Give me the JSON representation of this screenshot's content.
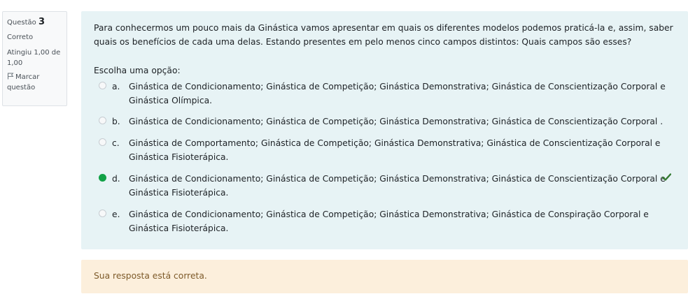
{
  "info": {
    "question_prefix": "Questão",
    "question_number": "3",
    "state": "Correto",
    "grade": "Atingiu 1,00 de 1,00",
    "flag_label": "Marcar questão"
  },
  "question": {
    "text": "Para conhecermos um pouco mais da Ginástica vamos apresentar em quais os diferentes modelos podemos praticá-la e, assim, saber quais os benefícios de cada uma delas. Estando presentes em pelo menos cinco campos distintos: Quais campos são esses?",
    "prompt": "Escolha uma opção:",
    "options": [
      {
        "label": "a.",
        "text": "Ginástica de Condicionamento; Ginástica de Competição; Ginástica Demonstrativa; Ginástica de Conscientização Corporal e Ginástica Olímpica.",
        "selected": false
      },
      {
        "label": "b.",
        "text": "Ginástica de Condicionamento; Ginástica de Competição; Ginástica Demonstrativa; Ginástica de Conscientização Corporal .",
        "selected": false
      },
      {
        "label": "c.",
        "text": "Ginástica de Comportamento; Ginástica de Competição; Ginástica Demonstrativa; Ginástica de Conscientização Corporal e Ginástica Fisioterápica.",
        "selected": false
      },
      {
        "label": "d.",
        "text": "Ginástica de Condicionamento; Ginástica de Competição; Ginástica Demonstrativa; Ginástica de Conscientização Corporal e Ginástica Fisioterápica.",
        "selected": true
      },
      {
        "label": "e.",
        "text": "Ginástica de Condicionamento; Ginástica de Competição; Ginástica Demonstrativa; Ginástica de Conspiração Corporal e Ginástica Fisioterápica.",
        "selected": false
      }
    ]
  },
  "feedback": {
    "text": "Sua resposta está correta."
  },
  "colors": {
    "selected_radio": "#11a146",
    "correct_check": "#357a32",
    "formulation_bg": "#e7f3f5",
    "outcome_bg": "#fcefdc",
    "feedback_text": "#7d5a29"
  },
  "icons": {
    "flag": "flag-icon",
    "correct": "check-icon"
  }
}
